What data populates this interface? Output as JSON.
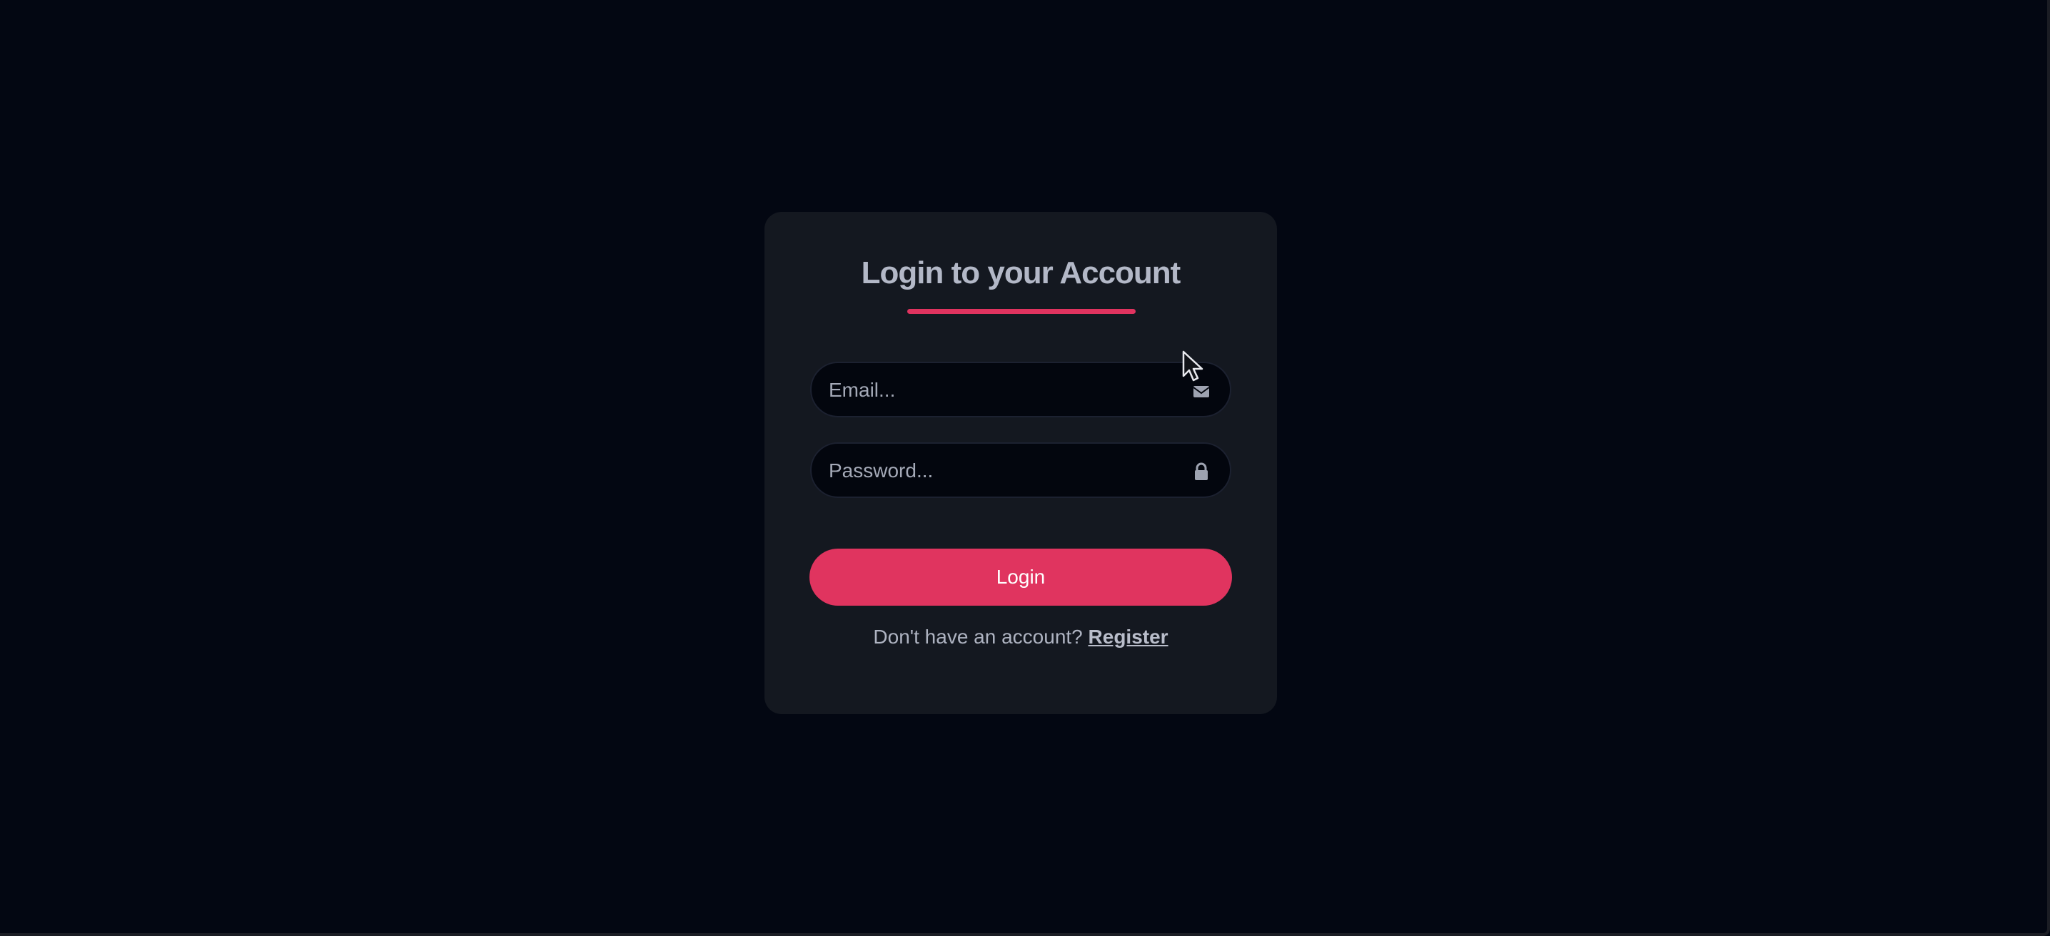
{
  "login_card": {
    "title": "Login to your Account",
    "email_field": {
      "placeholder": "Email...",
      "value": "",
      "icon": "envelope-icon"
    },
    "password_field": {
      "placeholder": "Password...",
      "value": "",
      "icon": "lock-icon"
    },
    "login_button_label": "Login",
    "register_prompt": "Don't have an account?",
    "register_link_label": "Register"
  },
  "colors": {
    "background": "#030712",
    "card": "#141820",
    "accent": "#e0345f",
    "text": "#b3b8c7"
  }
}
